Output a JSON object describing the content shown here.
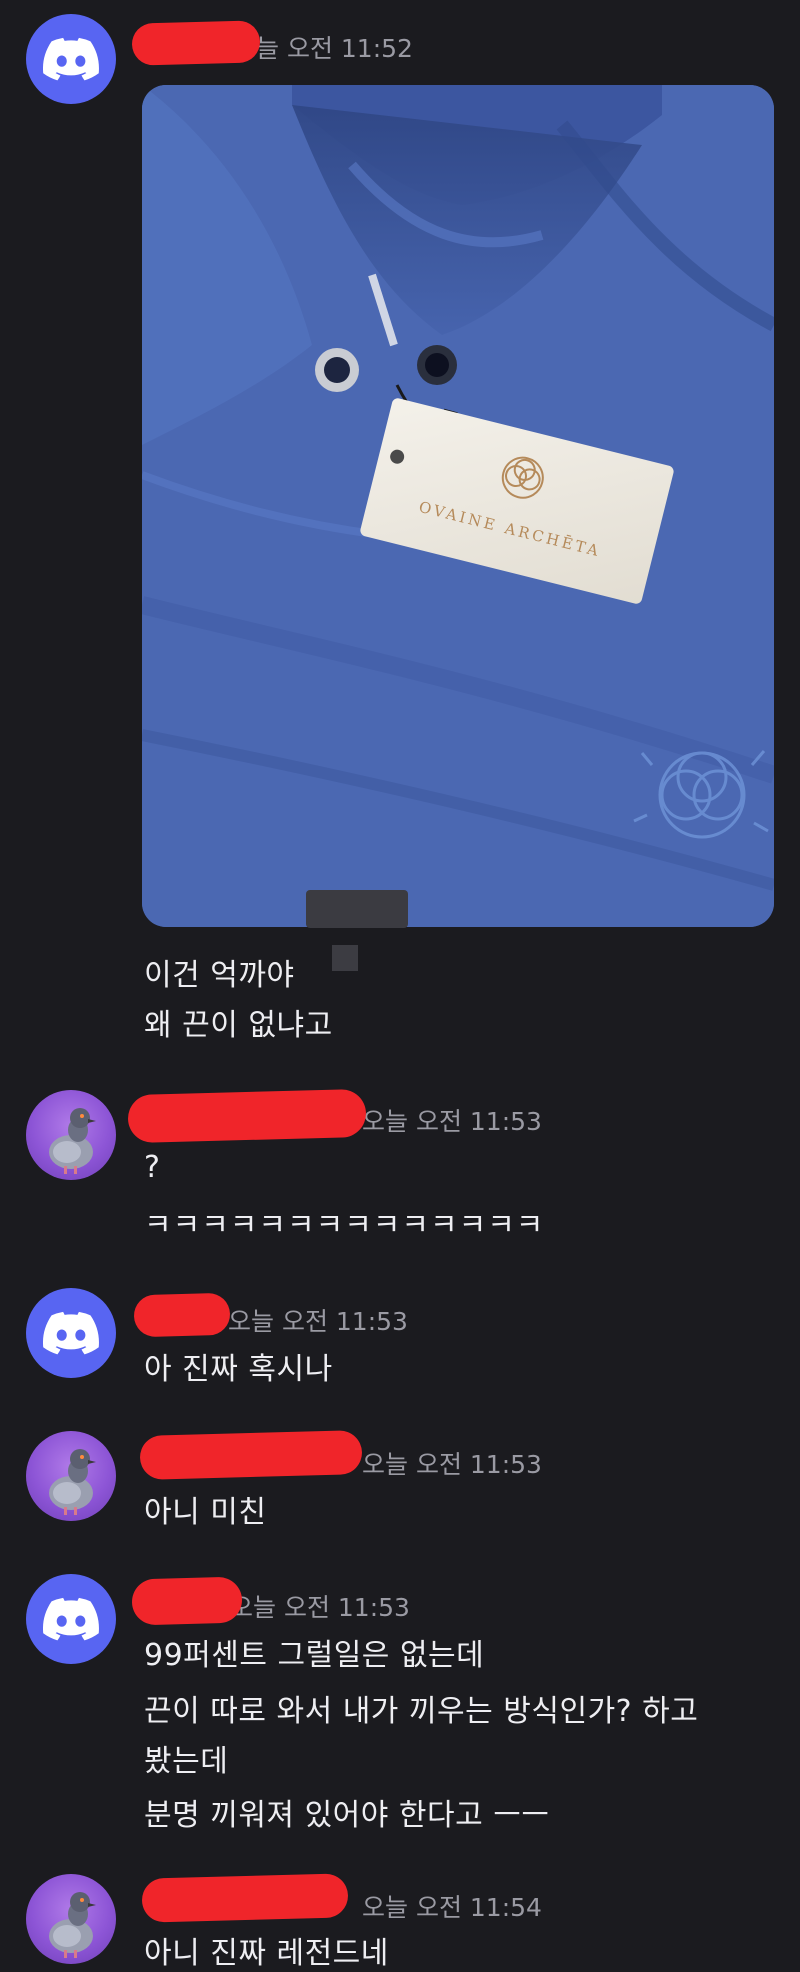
{
  "messages": [
    {
      "avatar": "discord-logo-icon",
      "username": "",
      "timestamp": "늘 오전 11:52",
      "attachment": {
        "tag_brand": "OVAINE ARCHĒTA"
      },
      "lines": [
        "이건 억까야",
        "왜 끈이 없냐고"
      ]
    },
    {
      "avatar": "pigeon-avatar",
      "username": "",
      "timestamp": "오늘 오전 11:53",
      "lines": [
        "?",
        "ㅋㅋㅋㅋㅋㅋㅋㅋㅋㅋㅋㅋㅋㅋ"
      ]
    },
    {
      "avatar": "discord-logo-icon",
      "username": "",
      "timestamp": "오늘 오전 11:53",
      "lines": [
        "아 진짜 혹시나"
      ]
    },
    {
      "avatar": "pigeon-avatar",
      "username": "",
      "timestamp": "오늘 오전 11:53",
      "lines": [
        "아니 미친"
      ]
    },
    {
      "avatar": "discord-logo-icon",
      "username": "",
      "timestamp": "오늘 오전 11:53",
      "lines": [
        "99퍼센트 그럴일은 없는데",
        "끈이 따로 와서 내가 끼우는 방식인가? 하고",
        "봤는데",
        "분명 끼워져 있어야 한다고 ㅡㅡ"
      ]
    },
    {
      "avatar": "pigeon-avatar",
      "username": "",
      "timestamp": "오늘 오전 11:54",
      "lines": [
        "아니 진짜 레전드네"
      ]
    }
  ],
  "colors": {
    "background": "#1b1b1f",
    "discord_blurple": "#5865f2",
    "pigeon_purple": "#8d55d6",
    "timestamp": "#9a9aa3",
    "redaction": "#f0252a"
  }
}
